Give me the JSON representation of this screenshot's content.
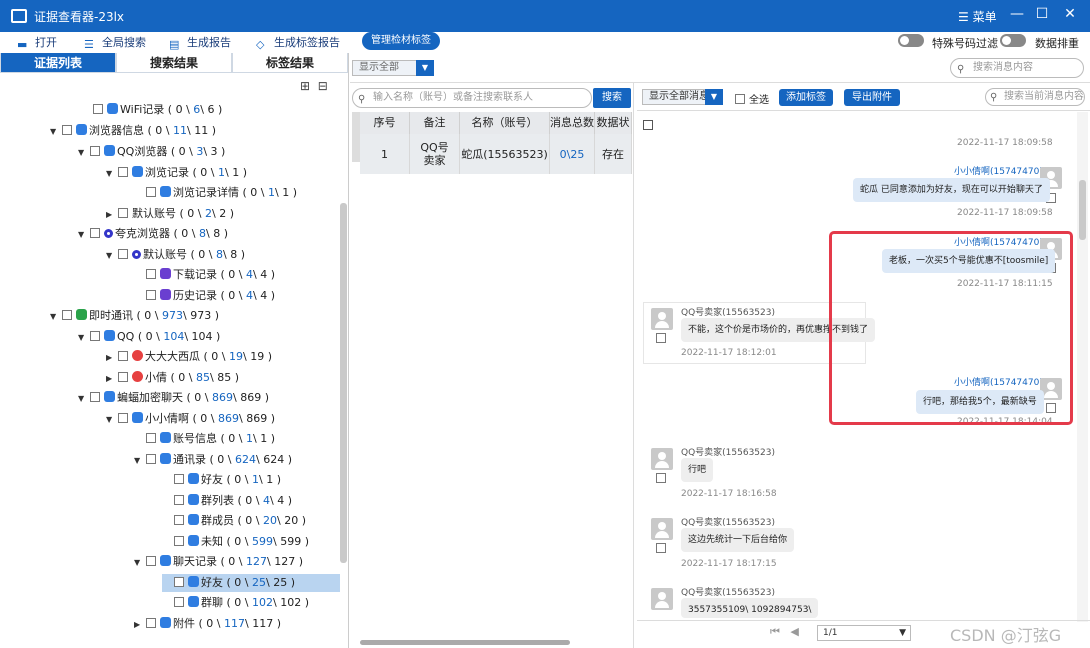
{
  "window": {
    "title": "证据查看器-23lx",
    "menu_label": "菜单",
    "minimize": "—",
    "maximize": "☐",
    "close": "✕"
  },
  "toolbar": {
    "open": "打开",
    "global_search": "全局搜索",
    "generate_report": "生成报告",
    "generate_tag_report": "生成标签报告",
    "manage_material_tags": "管理检材标签",
    "special_number_filter": "特殊号码过滤",
    "data_sort": "数据排重"
  },
  "left_tabs": [
    "证据列表",
    "搜索结果",
    "标签结果"
  ],
  "tree": [
    {
      "label": "WiFi记录",
      "a": "0",
      "b": "6",
      "c": "6"
    },
    {
      "label": "浏览器信息",
      "a": "0",
      "b": "11",
      "c": "11"
    },
    {
      "label": "QQ浏览器",
      "a": "0",
      "b": "3",
      "c": "3"
    },
    {
      "label": "浏览记录",
      "a": "0",
      "b": "1",
      "c": "1"
    },
    {
      "label": "浏览记录详情",
      "a": "0",
      "b": "1",
      "c": "1"
    },
    {
      "label": "默认账号",
      "a": "0",
      "b": "2",
      "c": "2"
    },
    {
      "label": "夸克浏览器",
      "a": "0",
      "b": "8",
      "c": "8"
    },
    {
      "label": "默认账号",
      "a": "0",
      "b": "8",
      "c": "8"
    },
    {
      "label": "下载记录",
      "a": "0",
      "b": "4",
      "c": "4"
    },
    {
      "label": "历史记录",
      "a": "0",
      "b": "4",
      "c": "4"
    },
    {
      "label": "即时通讯",
      "a": "0",
      "b": "973",
      "c": "973"
    },
    {
      "label": "QQ",
      "a": "0",
      "b": "104",
      "c": "104"
    },
    {
      "label": "大大大西瓜",
      "a": "0",
      "b": "19",
      "c": "19"
    },
    {
      "label": "小倩",
      "a": "0",
      "b": "85",
      "c": "85"
    },
    {
      "label": "蝙蝠加密聊天",
      "a": "0",
      "b": "869",
      "c": "869"
    },
    {
      "label": "小小倩啊",
      "a": "0",
      "b": "869",
      "c": "869"
    },
    {
      "label": "账号信息",
      "a": "0",
      "b": "1",
      "c": "1"
    },
    {
      "label": "通讯录",
      "a": "0",
      "b": "624",
      "c": "624"
    },
    {
      "label": "好友",
      "a": "0",
      "b": "1",
      "c": "1"
    },
    {
      "label": "群列表",
      "a": "0",
      "b": "4",
      "c": "4"
    },
    {
      "label": "群成员",
      "a": "0",
      "b": "20",
      "c": "20"
    },
    {
      "label": "未知",
      "a": "0",
      "b": "599",
      "c": "599"
    },
    {
      "label": "聊天记录",
      "a": "0",
      "b": "127",
      "c": "127"
    },
    {
      "label": "好友",
      "a": "0",
      "b": "25",
      "c": "25"
    },
    {
      "label": "群聊",
      "a": "0",
      "b": "102",
      "c": "102"
    },
    {
      "label": "附件",
      "a": "0",
      "b": "117",
      "c": "117"
    }
  ],
  "top_filter": {
    "value": "显示全部"
  },
  "top_search": {
    "placeholder": "搜索消息内容"
  },
  "contact_search": {
    "placeholder": "输入名称（账号）或备注搜索联系人",
    "button": "搜索"
  },
  "contact_table": {
    "headers": [
      "序号",
      "备注",
      "名称（账号）",
      "消息总数",
      "数据状"
    ],
    "rows": [
      [
        "1",
        "QQ号卖家",
        "蛇瓜(15563523)",
        "0\\25",
        "存在"
      ]
    ]
  },
  "chat": {
    "filter": "显示全部消息",
    "select_all": "全选",
    "add_tag": "添加标签",
    "export_attachments": "导出附件",
    "search_placeholder": "搜索当前消息内容",
    "messages": [
      {
        "ts": "2022-11-17 18:09:58"
      },
      {
        "sender": "小小倩啊(15747470)",
        "text": "蛇瓜 已同意添加为好友，现在可以开始聊天了",
        "ts": "2022-11-17 18:09:58"
      },
      {
        "sender": "小小倩啊(15747470)",
        "text": "老板，一次买5个号能优惠不[toosmile]",
        "ts": "2022-11-17 18:11:15"
      },
      {
        "sender": "QQ号卖家(15563523)",
        "text": "不能，这个价是市场价的，再优惠挣不到钱了",
        "ts": "2022-11-17 18:12:01"
      },
      {
        "sender": "小小倩啊(15747470)",
        "text": "行吧，那给我5个，最新缺号",
        "ts": "2022-11-17 18:14:04"
      },
      {
        "sender": "QQ号卖家(15563523)",
        "text": "行吧",
        "ts": "2022-11-17 18:16:58"
      },
      {
        "sender": "QQ号卖家(15563523)",
        "text": "这边先统计一下后台给你",
        "ts": "2022-11-17 18:17:15"
      },
      {
        "sender": "QQ号卖家(15563523)",
        "text": "3557355109\\ 1092894753\\"
      }
    ]
  },
  "pager": {
    "value": "1/1",
    "prev_first": "⏮",
    "prev": "◀"
  },
  "watermark": "CSDN @汀弦G",
  "colors": {
    "accent": "#1565c0",
    "highlight": "#e43a4a"
  }
}
